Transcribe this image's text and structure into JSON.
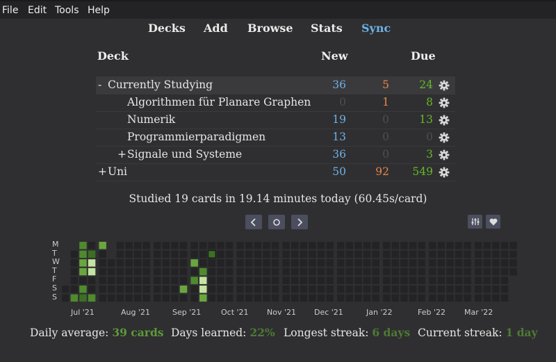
{
  "menubar": {
    "file": "File",
    "edit": "Edit",
    "tools": "Tools",
    "help": "Help"
  },
  "nav": {
    "decks": "Decks",
    "add": "Add",
    "browse": "Browse",
    "stats": "Stats",
    "sync": "Sync"
  },
  "table": {
    "headers": {
      "deck": "Deck",
      "new": "New",
      "due": "Due"
    },
    "rows": [
      {
        "expander": "-",
        "name": "Currently Studying",
        "new": "36",
        "learn": "5",
        "due": "24"
      },
      {
        "expander": "",
        "name": "Algorithmen für Planare Graphen",
        "new": "0",
        "learn": "1",
        "due": "8"
      },
      {
        "expander": "",
        "name": "Numerik",
        "new": "19",
        "learn": "0",
        "due": "13"
      },
      {
        "expander": "",
        "name": "Programmierparadigmen",
        "new": "13",
        "learn": "0",
        "due": "0"
      },
      {
        "expander": "+",
        "name": "Signale und Systeme",
        "new": "36",
        "learn": "0",
        "due": "3"
      },
      {
        "expander": "+",
        "name": "Uni",
        "new": "50",
        "learn": "92",
        "due": "549"
      }
    ]
  },
  "studied_today": "Studied 19 cards in 19.14 minutes today (60.45s/card)",
  "heatmap": {
    "day_labels": [
      "M",
      "T",
      "W",
      "T",
      "F",
      "S",
      "S"
    ],
    "months": [
      "Jul '21",
      "Aug '21",
      "Sep '21",
      "Oct '21",
      "Nov '21",
      "Dec '21",
      "Jan '22",
      "Feb '22",
      "Mar '22"
    ]
  },
  "stats": {
    "daily_average_label": "Daily average:",
    "daily_average_value": "39 cards",
    "days_learned_label": "Days learned:",
    "days_learned_value": "22%",
    "longest_streak_label": "Longest streak:",
    "longest_streak_value": "6 days",
    "current_streak_label": "Current streak:",
    "current_streak_value": "1 day"
  },
  "colors": {
    "new": "#6fb1e6",
    "learn": "#e8874a",
    "due": "#66b82a",
    "zero": "#4e4e50"
  }
}
